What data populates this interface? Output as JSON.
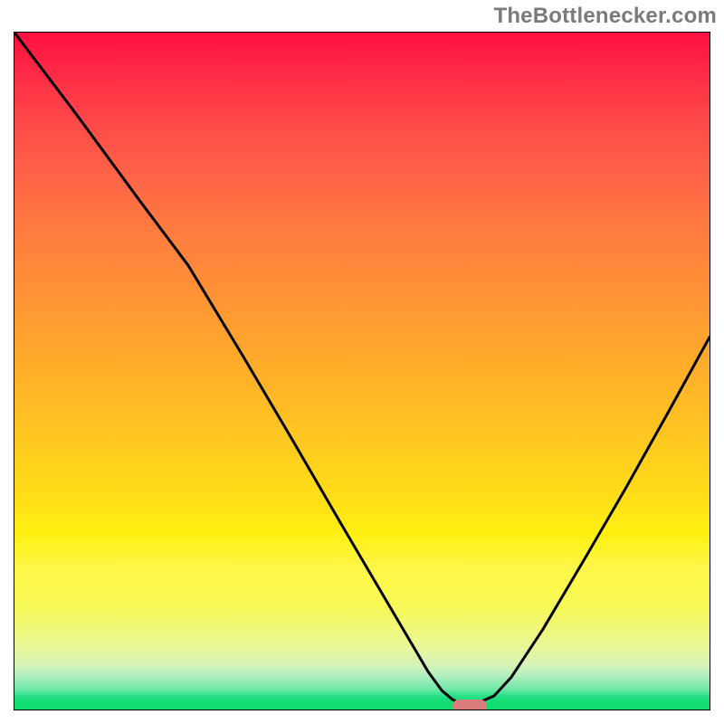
{
  "watermark": {
    "text": "TheBottlenecker.com"
  },
  "marker": {
    "color": "#db7c7c",
    "x_frac": 0.655,
    "y_frac": 0.994
  },
  "chart_data": {
    "type": "line",
    "title": "",
    "xlabel": "",
    "ylabel": "",
    "xlim": [
      0,
      1
    ],
    "ylim": [
      0,
      1
    ],
    "curve_points_frac": [
      [
        0.0,
        0.0
      ],
      [
        0.09,
        0.122
      ],
      [
        0.18,
        0.248
      ],
      [
        0.25,
        0.344
      ],
      [
        0.33,
        0.48
      ],
      [
        0.4,
        0.602
      ],
      [
        0.47,
        0.726
      ],
      [
        0.54,
        0.848
      ],
      [
        0.595,
        0.944
      ],
      [
        0.615,
        0.972
      ],
      [
        0.63,
        0.985
      ],
      [
        0.64,
        0.99
      ],
      [
        0.665,
        0.991
      ],
      [
        0.69,
        0.98
      ],
      [
        0.715,
        0.952
      ],
      [
        0.76,
        0.882
      ],
      [
        0.82,
        0.778
      ],
      [
        0.88,
        0.672
      ],
      [
        0.94,
        0.562
      ],
      [
        1.0,
        0.45
      ]
    ],
    "gradient_stops": [
      {
        "pos": 0.0,
        "color": "#ff1040"
      },
      {
        "pos": 0.5,
        "color": "#ffbf24"
      },
      {
        "pos": 0.78,
        "color": "#fff524"
      },
      {
        "pos": 0.99,
        "color": "#10dc70"
      }
    ],
    "marker": {
      "x": 0.655,
      "y": 0.994,
      "shape": "pill",
      "color": "#db7c7c"
    }
  }
}
